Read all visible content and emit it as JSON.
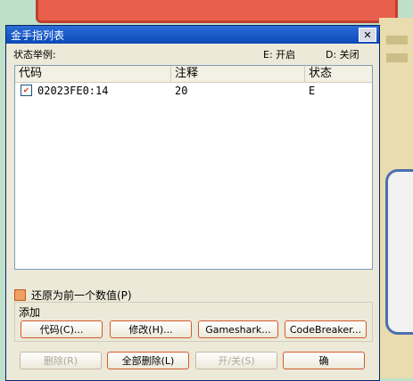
{
  "window": {
    "title": "金手指列表",
    "close_label": "✕"
  },
  "legend": {
    "label": "状态举例:",
    "enabled": "E: 开启",
    "disabled": "D: 关闭"
  },
  "table": {
    "columns": [
      "代码",
      "注释",
      "状态"
    ],
    "rows": [
      {
        "code": "02023FE0:14",
        "note": "20",
        "state": "E",
        "checked": true
      }
    ]
  },
  "restore_label": "还原为前一个数值(P)",
  "add_group": {
    "label": "添加",
    "buttons": [
      "代码(C)...",
      "修改(H)...",
      "Gameshark...",
      "CodeBreaker..."
    ]
  },
  "bottom_buttons": [
    "删除(R)",
    "全部删除(L)",
    "开/关(S)",
    "确"
  ]
}
